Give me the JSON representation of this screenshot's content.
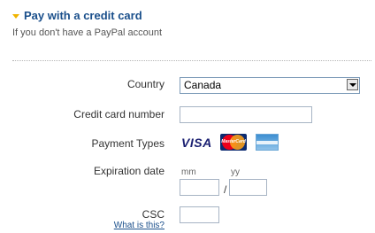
{
  "section": {
    "title": "Pay with a credit card",
    "subtitle": "If you don't have a PayPal account"
  },
  "form": {
    "country": {
      "label": "Country",
      "value": "Canada"
    },
    "card_number": {
      "label": "Credit card number",
      "value": ""
    },
    "payment_types": {
      "label": "Payment Types",
      "cards": [
        "VISA",
        "MasterCard",
        "American Express"
      ],
      "visa_text": "VISA",
      "mastercard_text": "MasterCard"
    },
    "expiration": {
      "label": "Expiration date",
      "month_label": "mm",
      "year_label": "yy",
      "separator": "/",
      "month_value": "",
      "year_value": ""
    },
    "csc": {
      "label": "CSC",
      "help_link": "What is this?",
      "value": ""
    }
  },
  "colors": {
    "accent": "#1a4f8b",
    "caret": "#f0b400"
  }
}
